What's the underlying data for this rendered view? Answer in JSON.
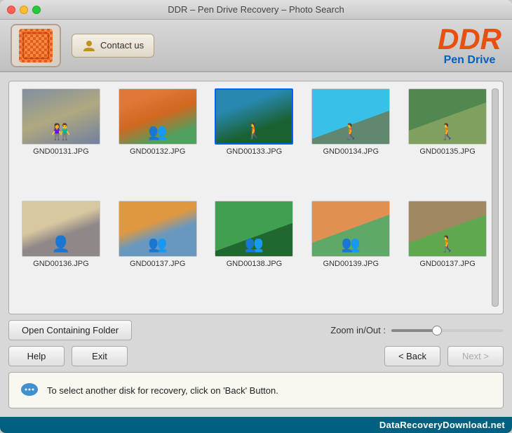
{
  "window": {
    "title": "DDR – Pen Drive Recovery – Photo Search"
  },
  "header": {
    "contact_label": "Contact us",
    "brand_name": "DDR",
    "brand_sub": "Pen Drive"
  },
  "photos": [
    {
      "id": "GND00131.JPG",
      "thumb_class": "thumb-1",
      "selected": false
    },
    {
      "id": "GND00132.JPG",
      "thumb_class": "thumb-2",
      "selected": false
    },
    {
      "id": "GND00133.JPG",
      "thumb_class": "thumb-3",
      "selected": true
    },
    {
      "id": "GND00134.JPG",
      "thumb_class": "thumb-4",
      "selected": false
    },
    {
      "id": "GND00135.JPG",
      "thumb_class": "thumb-5",
      "selected": false
    },
    {
      "id": "GND00136.JPG",
      "thumb_class": "thumb-6",
      "selected": false
    },
    {
      "id": "GND00137.JPG",
      "thumb_class": "thumb-7",
      "selected": false
    },
    {
      "id": "GND00138.JPG",
      "thumb_class": "thumb-8",
      "selected": false
    },
    {
      "id": "GND00139.JPG",
      "thumb_class": "thumb-9",
      "selected": false
    },
    {
      "id": "GND00137.JPG",
      "thumb_class": "thumb-10",
      "selected": false
    }
  ],
  "controls": {
    "open_folder": "Open Containing Folder",
    "zoom_label": "Zoom in/Out :",
    "help": "Help",
    "exit": "Exit",
    "back": "< Back",
    "next": "Next >"
  },
  "info": {
    "message": "To select another disk for recovery, click on 'Back' Button."
  },
  "watermark": {
    "text": "DataRecoveryDownload.net"
  }
}
